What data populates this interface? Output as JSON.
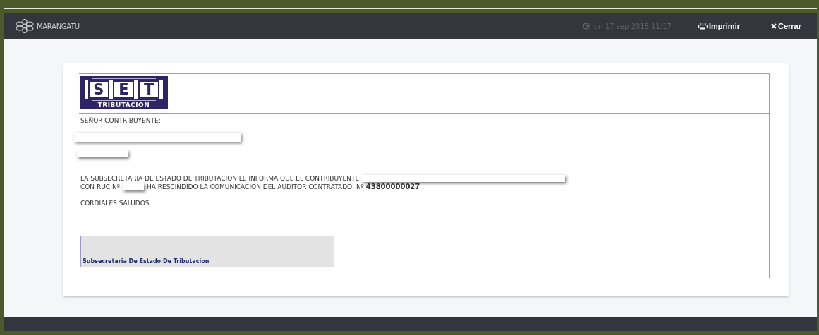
{
  "header": {
    "brand": "MARANGATU",
    "datetime": "lun 17 sep 2018 11:17",
    "actions": [
      {
        "kind": "print",
        "label": "Imprimir"
      },
      {
        "kind": "close",
        "label": "Cerrar"
      }
    ]
  },
  "document": {
    "logo": {
      "letters": [
        "S",
        "E",
        "T"
      ],
      "bottom_line": "TRIBUTACION"
    },
    "salutation": "SEÑOR CONTRIBUYENTE:",
    "redacted_lines": [
      {
        "kind": "long"
      },
      {
        "kind": "short"
      }
    ],
    "message_lines": [
      [
        {
          "kind": "text",
          "text": "LA SUBSECRETARIA DE ESTADO DE TRIBUTACION LE INFORMA QUE EL CONTRIBUYENTE"
        },
        {
          "kind": "redacted_long"
        }
      ],
      [
        {
          "kind": "text",
          "text": "CON RUC Nº"
        },
        {
          "kind": "redacted_short"
        },
        {
          "kind": "text",
          "text": "HA RESCINDIDO LA COMUNICACION DEL AUDITOR CONTRATADO, Nº **43800000027** ."
        }
      ]
    ],
    "closing": "CORDIALES SALUDOS.",
    "signature": "Subsecretaria De Estado De Tributacion"
  }
}
